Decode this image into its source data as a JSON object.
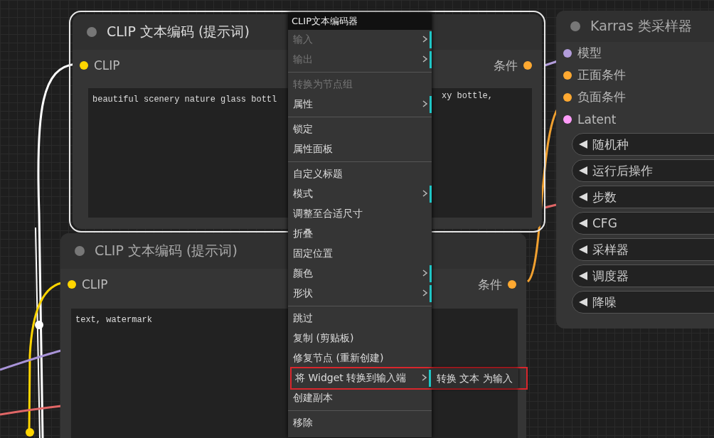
{
  "nodes": [
    {
      "title": "CLIP 文本编码 (提示词)",
      "selected": true,
      "inputs": [
        {
          "label": "CLIP",
          "color": "#ffd500"
        }
      ],
      "outputs": [
        {
          "label": "条件",
          "color": "#ffa931"
        }
      ],
      "text_parts": [
        "beautiful scenery nature glass bottl",
        "xy bottle,"
      ]
    },
    {
      "title": "CLIP 文本编码 (提示词)",
      "selected": false,
      "inputs": [
        {
          "label": "CLIP",
          "color": "#ffd500"
        }
      ],
      "outputs": [
        {
          "label": "条件",
          "color": "#ffa931"
        }
      ],
      "text_parts": [
        "text, watermark"
      ]
    },
    {
      "title": "Karras 类采样器",
      "selected": false,
      "inputs": [
        {
          "label": "模型",
          "color": "#b39ddb"
        },
        {
          "label": "正面条件",
          "color": "#ffa931"
        },
        {
          "label": "负面条件",
          "color": "#ffa931"
        },
        {
          "label": "Latent",
          "color": "#ff9cf9"
        }
      ],
      "widgets": [
        "随机种",
        "运行后操作",
        "步数",
        "CFG",
        "采样器",
        "调度器",
        "降噪"
      ]
    }
  ],
  "context_menu": {
    "title": "CLIP文本编码器",
    "groups": [
      [
        {
          "label": "输入",
          "disabled": true,
          "has_submenu": true,
          "highlighted": false
        },
        {
          "label": "输出",
          "disabled": true,
          "has_submenu": true,
          "highlighted": false
        }
      ],
      [
        {
          "label": "转换为节点组",
          "disabled": true,
          "has_submenu": false,
          "highlighted": false
        },
        {
          "label": "属性",
          "disabled": false,
          "has_submenu": true,
          "highlighted": false
        }
      ],
      [
        {
          "label": "锁定",
          "disabled": false,
          "has_submenu": false,
          "highlighted": false
        },
        {
          "label": "属性面板",
          "disabled": false,
          "has_submenu": false,
          "highlighted": false
        }
      ],
      [
        {
          "label": "自定义标题",
          "disabled": false,
          "has_submenu": false,
          "highlighted": false
        },
        {
          "label": "模式",
          "disabled": false,
          "has_submenu": true,
          "highlighted": false
        },
        {
          "label": "调整至合适尺寸",
          "disabled": false,
          "has_submenu": false,
          "highlighted": false
        },
        {
          "label": "折叠",
          "disabled": false,
          "has_submenu": false,
          "highlighted": false
        },
        {
          "label": "固定位置",
          "disabled": false,
          "has_submenu": false,
          "highlighted": false
        },
        {
          "label": "颜色",
          "disabled": false,
          "has_submenu": true,
          "highlighted": false
        },
        {
          "label": "形状",
          "disabled": false,
          "has_submenu": true,
          "highlighted": false
        }
      ],
      [
        {
          "label": "跳过",
          "disabled": false,
          "has_submenu": false,
          "highlighted": false
        },
        {
          "label": "复制 (剪贴板)",
          "disabled": false,
          "has_submenu": false,
          "highlighted": false
        },
        {
          "label": "修复节点 (重新创建)",
          "disabled": false,
          "has_submenu": false,
          "highlighted": false
        },
        {
          "label": "将 Widget 转换到输入端",
          "disabled": false,
          "has_submenu": true,
          "highlighted": true,
          "submenu_items": [
            "转换 文本 为输入"
          ]
        },
        {
          "label": "创建副本",
          "disabled": false,
          "has_submenu": false,
          "highlighted": false
        }
      ],
      [
        {
          "label": "移除",
          "disabled": false,
          "has_submenu": false,
          "highlighted": false
        }
      ]
    ]
  }
}
